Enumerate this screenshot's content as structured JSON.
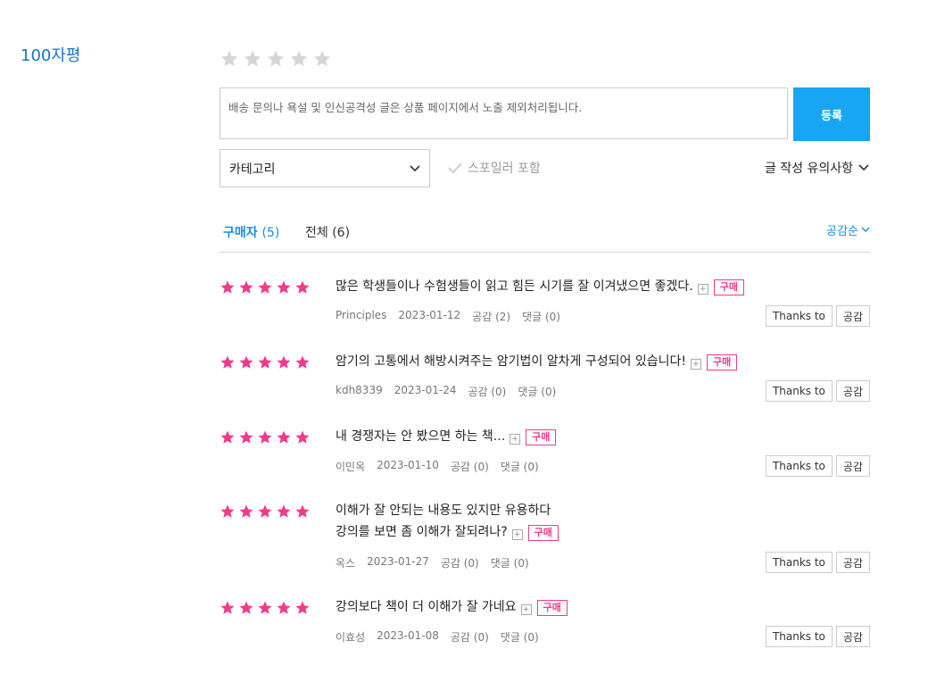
{
  "section_title": "100자평",
  "rating_input": {
    "value": 0,
    "max": 5
  },
  "composer": {
    "placeholder": "배송 문의나 욕설 및 인신공격성 글은 상품 페이지에서 노출 제외처리됩니다.",
    "submit_label": "등록"
  },
  "category": {
    "selected": "카테고리"
  },
  "spoiler": {
    "label": "스포일러 포함"
  },
  "guide": {
    "label": "글 작성 유의사항"
  },
  "tabs": [
    {
      "label": "구매자",
      "count": "(5)"
    },
    {
      "label": "전체",
      "count": "(6)"
    }
  ],
  "sort": {
    "label": "공감순"
  },
  "reviews": [
    {
      "rating": 5,
      "lines": [
        "많은 학생들이나 수험생들이 읽고 힘든 시기를 잘 이겨냈으면 좋겠다."
      ],
      "badge": "구매",
      "author": "Principles",
      "date": "2023-01-12",
      "likes": "공감 (2)",
      "comments": "댓글 (0)",
      "thanks": "Thanks to",
      "empathy": "공감"
    },
    {
      "rating": 5,
      "lines": [
        "암기의 고통에서 해방시켜주는 암기법이 알차게 구성되어 있습니다!"
      ],
      "badge": "구매",
      "author": "kdh8339",
      "date": "2023-01-24",
      "likes": "공감 (0)",
      "comments": "댓글 (0)",
      "thanks": "Thanks to",
      "empathy": "공감"
    },
    {
      "rating": 5,
      "lines": [
        "내 경쟁자는 안 봤으면 하는 책..."
      ],
      "badge": "구매",
      "author": "이민옥",
      "date": "2023-01-10",
      "likes": "공감 (0)",
      "comments": "댓글 (0)",
      "thanks": "Thanks to",
      "empathy": "공감"
    },
    {
      "rating": 5,
      "lines": [
        "이해가 잘 안되는 내용도 있지만 유용하다",
        "강의를 보면 좀 이해가 잘되려나?"
      ],
      "badge": "구매",
      "author": "옥스",
      "date": "2023-01-27",
      "likes": "공감 (0)",
      "comments": "댓글 (0)",
      "thanks": "Thanks to",
      "empathy": "공감"
    },
    {
      "rating": 5,
      "lines": [
        "강의보다 책이 더 이해가 잘 가네요"
      ],
      "badge": "구매",
      "author": "이효성",
      "date": "2023-01-08",
      "likes": "공감 (0)",
      "comments": "댓글 (0)",
      "thanks": "Thanks to",
      "empathy": "공감"
    }
  ]
}
